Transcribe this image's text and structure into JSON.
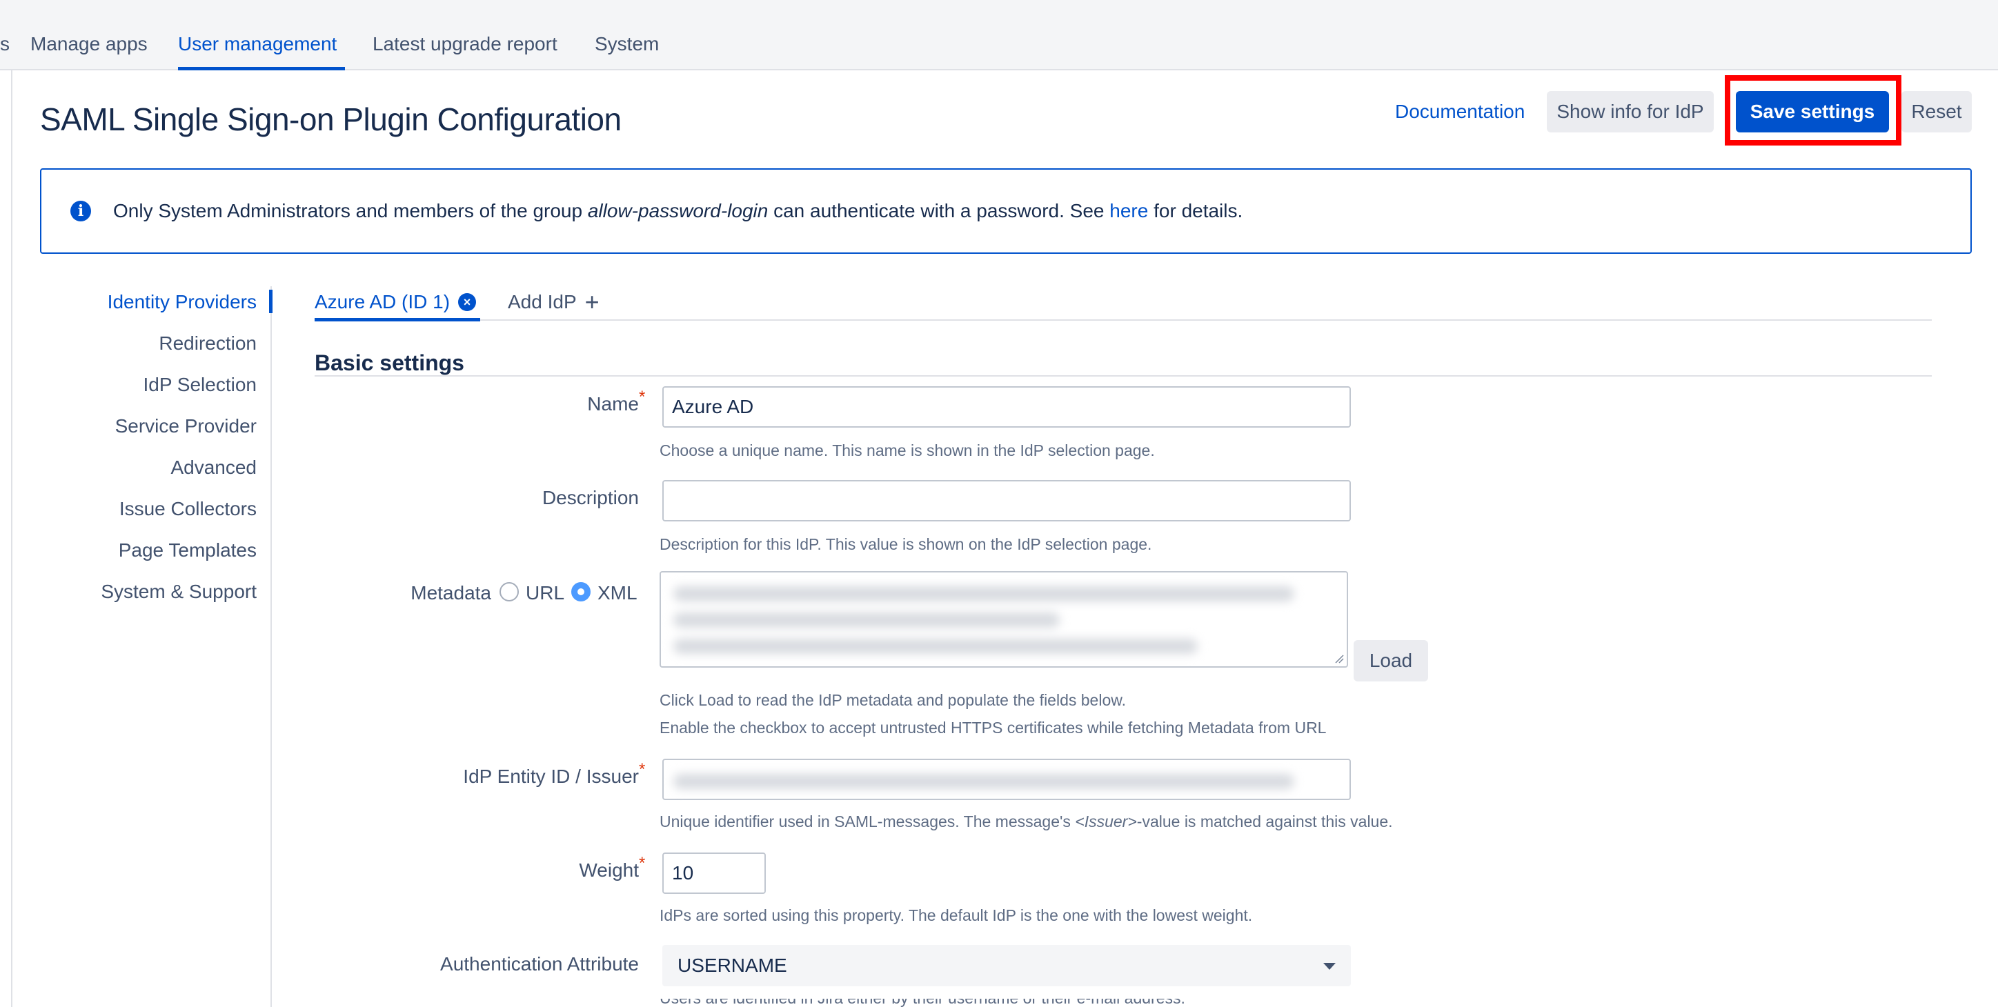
{
  "topnav": {
    "partial": "s",
    "tabs": [
      {
        "label": "Manage apps"
      },
      {
        "label": "User management"
      },
      {
        "label": "Latest upgrade report"
      },
      {
        "label": "System"
      }
    ],
    "active_tab": "User management"
  },
  "page": {
    "title": "SAML Single Sign-on Plugin Configuration"
  },
  "actions": {
    "documentation": "Documentation",
    "show_info": "Show info for IdP",
    "save": "Save settings",
    "reset": "Reset"
  },
  "info_banner": {
    "icon": "info-icon",
    "text_before": "Only System Administrators and members of the group ",
    "group": "allow-password-login",
    "text_middle": " can authenticate with a password. See ",
    "link": "here",
    "text_after": " for details."
  },
  "sidenav": {
    "items": [
      {
        "label": "Identity Providers"
      },
      {
        "label": "Redirection"
      },
      {
        "label": "IdP Selection"
      },
      {
        "label": "Service Provider"
      },
      {
        "label": "Advanced"
      },
      {
        "label": "Issue Collectors"
      },
      {
        "label": "Page Templates"
      },
      {
        "label": "System & Support"
      }
    ],
    "active": "Identity Providers"
  },
  "idp_tabs": {
    "active": "Azure AD (ID 1)",
    "add": "Add IdP"
  },
  "section": {
    "title": "Basic settings"
  },
  "form": {
    "name": {
      "label": "Name",
      "value": "Azure AD",
      "help": "Choose a unique name. This name is shown in the IdP selection page."
    },
    "description": {
      "label": "Description",
      "value": "",
      "help": "Description for this IdP. This value is shown on the IdP selection page."
    },
    "metadata": {
      "label": "Metadata",
      "options": [
        "URL",
        "XML"
      ],
      "selected": "XML",
      "load": "Load",
      "help1": "Click Load to read the IdP metadata and populate the fields below.",
      "help2": "Enable the checkbox to accept untrusted HTTPS certificates while fetching Metadata from URL"
    },
    "issuer": {
      "label": "IdP Entity ID / Issuer",
      "help_before": "Unique identifier used in SAML-messages. The message's ",
      "help_em": "<Issuer>",
      "help_after": "-value is matched against this value."
    },
    "weight": {
      "label": "Weight",
      "value": "10",
      "help": "IdPs are sorted using this property. The default IdP is the one with the lowest weight."
    },
    "auth_attribute": {
      "label": "Authentication Attribute",
      "value": "USERNAME",
      "help": "Users are identified in Jira either by their username or their e-mail address."
    }
  },
  "colors": {
    "accent": "#0052CC",
    "highlight": "#FF0000",
    "required": "#DE350B"
  }
}
